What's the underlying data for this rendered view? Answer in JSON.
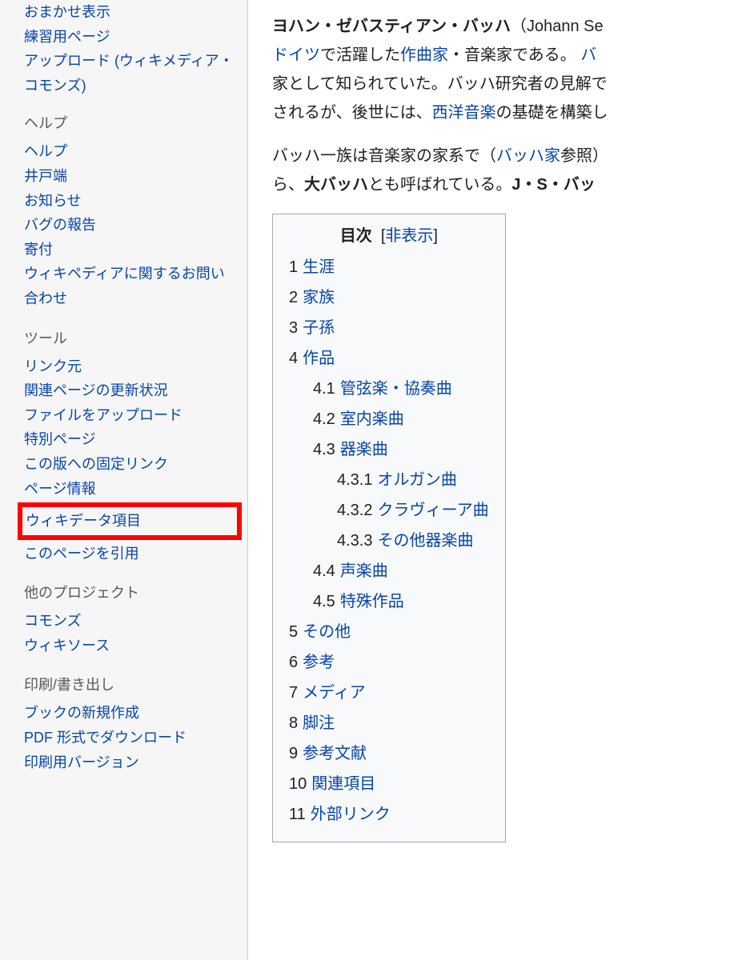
{
  "sidebar": {
    "top_items": [
      "おまかせ表示",
      "練習用ページ",
      "アップロード (ウィキメディア・コモンズ)"
    ],
    "sections": [
      {
        "heading": "ヘルプ",
        "items": [
          "ヘルプ",
          "井戸端",
          "お知らせ",
          "バグの報告",
          "寄付",
          "ウィキペディアに関するお問い合わせ"
        ]
      },
      {
        "heading": "ツール",
        "items": [
          "リンク元",
          "関連ページの更新状況",
          "ファイルをアップロード",
          "特別ページ",
          "この版への固定リンク",
          "ページ情報",
          "ウィキデータ項目",
          "このページを引用"
        ],
        "highlight_index": 6
      },
      {
        "heading": "他のプロジェクト",
        "items": [
          "コモンズ",
          "ウィキソース"
        ]
      },
      {
        "heading": "印刷/書き出し",
        "items": [
          "ブックの新規作成",
          "PDF 形式でダウンロード",
          "印刷用バージョン"
        ]
      }
    ]
  },
  "article": {
    "para1_parts": {
      "p1a": "ヨハン・ゼバスティアン・バッハ",
      "p1b": "（Johann Se",
      "p1c": "ドイツ",
      "p1d": "で活躍した",
      "p1e": "作曲家",
      "p1f": "・音楽家である。 ",
      "p1g": "バ",
      "p1h": "家として知られていた。バッハ研究者の見解で",
      "p1i": "されるが、後世には、",
      "p1j": "西洋音楽",
      "p1k": "の基礎を構築し"
    },
    "para2_parts": {
      "p2a": "バッハ一族は音楽家の家系で（",
      "p2b": "バッハ家",
      "p2c": "参照）",
      "p2d": "ら、",
      "p2e": "大バッハ",
      "p2f": "とも呼ばれている。",
      "p2g": "J・S・バッ"
    },
    "toc": {
      "title": "目次",
      "toggle_open": "[",
      "toggle_text": "非表示",
      "toggle_close": "]",
      "items": [
        {
          "num": "1",
          "text": "生涯",
          "level": 0
        },
        {
          "num": "2",
          "text": "家族",
          "level": 0
        },
        {
          "num": "3",
          "text": "子孫",
          "level": 0
        },
        {
          "num": "4",
          "text": "作品",
          "level": 0
        },
        {
          "num": "4.1",
          "text": "管弦楽・協奏曲",
          "level": 1
        },
        {
          "num": "4.2",
          "text": "室内楽曲",
          "level": 1
        },
        {
          "num": "4.3",
          "text": "器楽曲",
          "level": 1
        },
        {
          "num": "4.3.1",
          "text": "オルガン曲",
          "level": 2
        },
        {
          "num": "4.3.2",
          "text": "クラヴィーア曲",
          "level": 2
        },
        {
          "num": "4.3.3",
          "text": "その他器楽曲",
          "level": 2
        },
        {
          "num": "4.4",
          "text": "声楽曲",
          "level": 1
        },
        {
          "num": "4.5",
          "text": "特殊作品",
          "level": 1
        },
        {
          "num": "5",
          "text": "その他",
          "level": 0
        },
        {
          "num": "6",
          "text": "参考",
          "level": 0
        },
        {
          "num": "7",
          "text": "メディア",
          "level": 0
        },
        {
          "num": "8",
          "text": "脚注",
          "level": 0
        },
        {
          "num": "9",
          "text": "参考文献",
          "level": 0
        },
        {
          "num": "10",
          "text": "関連項目",
          "level": 0
        },
        {
          "num": "11",
          "text": "外部リンク",
          "level": 0
        }
      ]
    }
  }
}
